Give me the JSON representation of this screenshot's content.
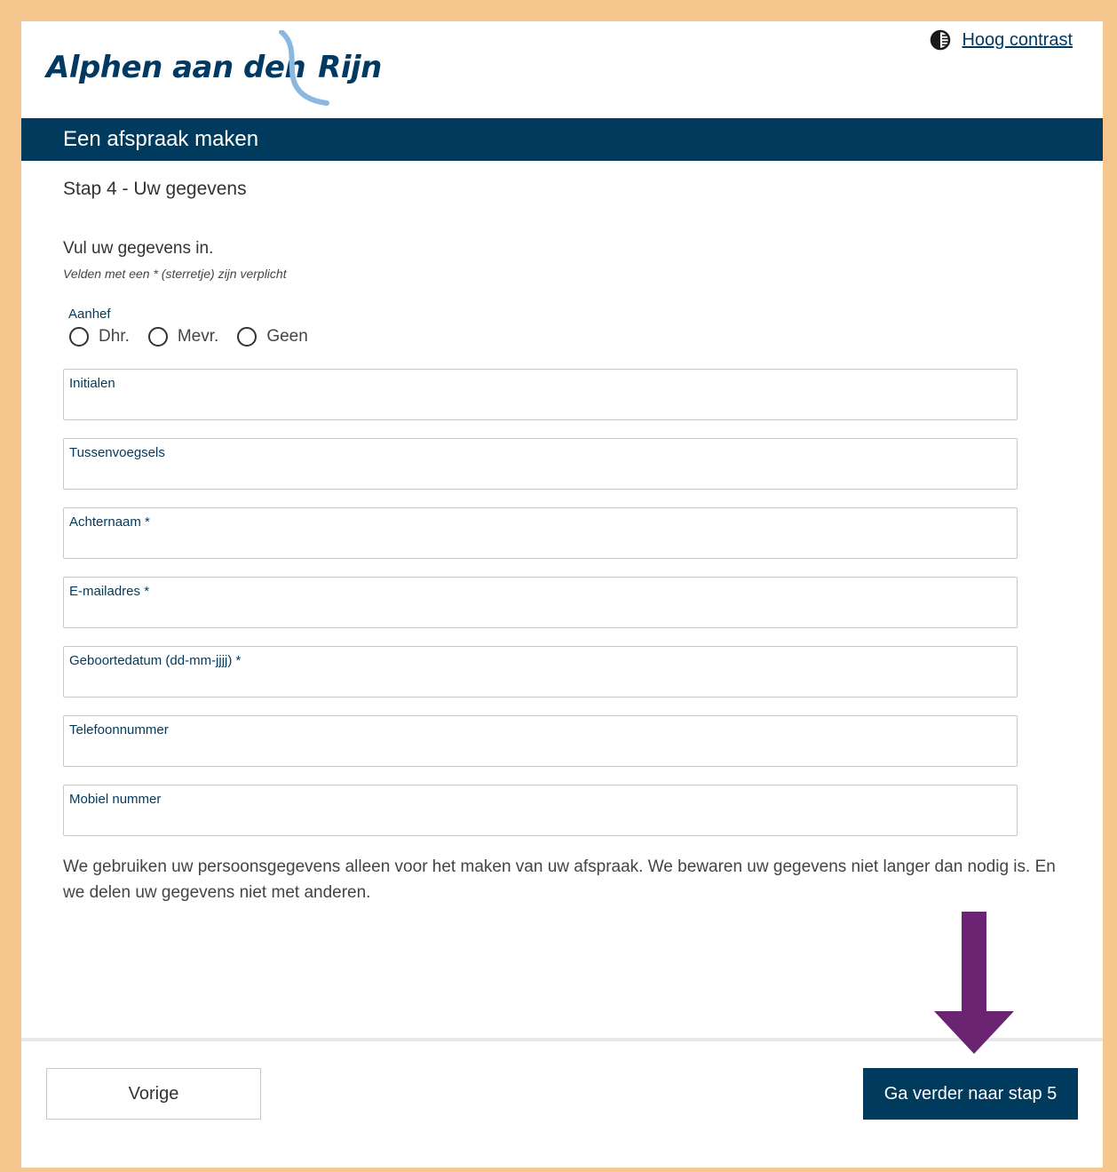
{
  "header": {
    "logo_text": "Alphen aan den Rijn",
    "logo_display": "Alphen aan den",
    "logo_display_end": "Rijn",
    "contrast_label": "Hoog contrast"
  },
  "banner": {
    "title": "Een afspraak maken"
  },
  "step": {
    "title": "Stap 4 - Uw gegevens"
  },
  "form": {
    "intro": "Vul uw gegevens in.",
    "required_note": "Velden met een * (sterretje) zijn verplicht",
    "aanhef_label": "Aanhef",
    "radio_options": [
      "Dhr.",
      "Mevr.",
      "Geen"
    ],
    "fields": [
      {
        "label": "Initialen",
        "value": ""
      },
      {
        "label": "Tussenvoegsels",
        "value": ""
      },
      {
        "label": "Achternaam *",
        "value": ""
      },
      {
        "label": "E-mailadres *",
        "value": ""
      },
      {
        "label": "Geboortedatum (dd-mm-jjjj) *",
        "value": ""
      },
      {
        "label": "Telefoonnummer",
        "value": ""
      },
      {
        "label": "Mobiel nummer",
        "value": ""
      }
    ],
    "privacy_text": "We gebruiken uw persoonsgegevens alleen voor het maken van uw afspraak. We bewaren uw gegevens niet langer dan nodig is. En we delen uw gegevens niet met anderen."
  },
  "footer": {
    "prev_label": "Vorige",
    "next_label": "Ga verder naar stap 5"
  },
  "colors": {
    "page_border": "#f5c68e",
    "brand_navy": "#003a5c",
    "logo_wave": "#8ab8e0",
    "annotation_arrow": "#6b2472"
  },
  "icons": {
    "contrast": "half-circle-contrast-icon",
    "annotation": "arrow-down-icon"
  }
}
